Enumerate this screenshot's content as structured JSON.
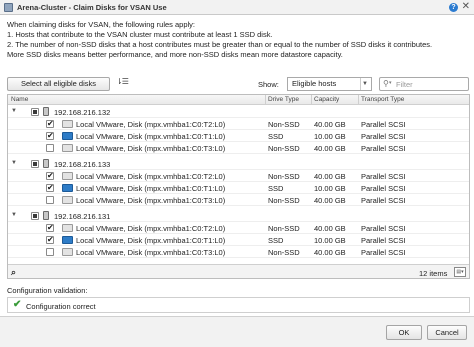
{
  "window": {
    "title": "Arena-Cluster - Claim Disks for VSAN Use"
  },
  "intro": {
    "line1": "When claiming disks for VSAN, the following rules apply:",
    "line2": "1. Hosts that contribute to the VSAN cluster must contribute at least 1 SSD disk.",
    "line3": "2. The number of non-SSD disks that a host contributes must be greater than or equal to the number of SSD disks it contributes.",
    "line4": "More SSD disks means better performance, and more non-SSD disks mean more datastore capacity."
  },
  "toolbar": {
    "select_all_label": "Select all eligible disks",
    "show_label": "Show:",
    "show_value": "Eligible hosts",
    "filter_placeholder": "Filter"
  },
  "columns": {
    "name": "Name",
    "drive_type": "Drive Type",
    "capacity": "Capacity",
    "transport_type": "Transport Type"
  },
  "hosts": [
    {
      "name": "192.168.216.132",
      "disks": [
        {
          "name": "Local VMware, Disk (mpx.vmhba1:C0:T2:L0)",
          "drive_type": "Non-SSD",
          "capacity": "40.00 GB",
          "transport": "Parallel SCSI",
          "checked": true,
          "icon": "disk-icon"
        },
        {
          "name": "Local VMware, Disk (mpx.vmhba1:C0:T1:L0)",
          "drive_type": "SSD",
          "capacity": "10.00 GB",
          "transport": "Parallel SCSI",
          "checked": true,
          "icon": "ssd-icon"
        },
        {
          "name": "Local VMware, Disk (mpx.vmhba1:C0:T3:L0)",
          "drive_type": "Non-SSD",
          "capacity": "40.00 GB",
          "transport": "Parallel SCSI",
          "checked": false,
          "icon": "disk-icon"
        }
      ]
    },
    {
      "name": "192.168.216.133",
      "disks": [
        {
          "name": "Local VMware, Disk (mpx.vmhba1:C0:T2:L0)",
          "drive_type": "Non-SSD",
          "capacity": "40.00 GB",
          "transport": "Parallel SCSI",
          "checked": true,
          "icon": "disk-icon"
        },
        {
          "name": "Local VMware, Disk (mpx.vmhba1:C0:T1:L0)",
          "drive_type": "SSD",
          "capacity": "10.00 GB",
          "transport": "Parallel SCSI",
          "checked": true,
          "icon": "ssd-icon"
        },
        {
          "name": "Local VMware, Disk (mpx.vmhba1:C0:T3:L0)",
          "drive_type": "Non-SSD",
          "capacity": "40.00 GB",
          "transport": "Parallel SCSI",
          "checked": false,
          "icon": "disk-icon"
        }
      ]
    },
    {
      "name": "192.168.216.131",
      "disks": [
        {
          "name": "Local VMware, Disk (mpx.vmhba1:C0:T2:L0)",
          "drive_type": "Non-SSD",
          "capacity": "40.00 GB",
          "transport": "Parallel SCSI",
          "checked": true,
          "icon": "disk-icon"
        },
        {
          "name": "Local VMware, Disk (mpx.vmhba1:C0:T1:L0)",
          "drive_type": "SSD",
          "capacity": "10.00 GB",
          "transport": "Parallel SCSI",
          "checked": true,
          "icon": "ssd-icon"
        },
        {
          "name": "Local VMware, Disk (mpx.vmhba1:C0:T3:L0)",
          "drive_type": "Non-SSD",
          "capacity": "40.00 GB",
          "transport": "Parallel SCSI",
          "checked": false,
          "icon": "disk-icon"
        }
      ]
    }
  ],
  "footer": {
    "items_count": "12 items"
  },
  "validation": {
    "label": "Configuration validation:",
    "message": "Configuration correct"
  },
  "buttons": {
    "ok": "OK",
    "cancel": "Cancel"
  },
  "colors": {
    "ssd_icon": "#2e7cc7",
    "success_check": "#3a9b3a"
  }
}
